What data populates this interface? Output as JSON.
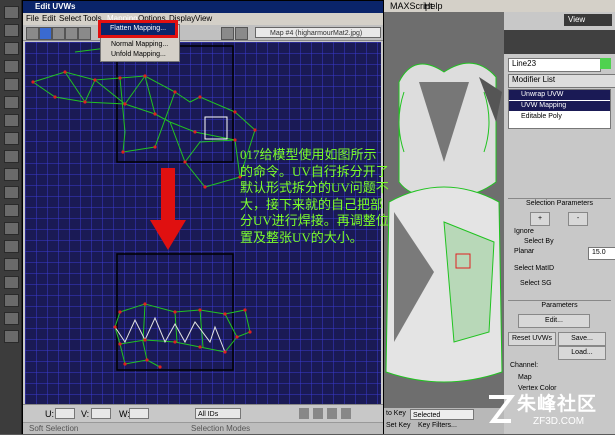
{
  "uvw_window": {
    "title": "Edit UVWs",
    "menu": [
      "File",
      "Edit",
      "Select",
      "Tools",
      "Mapping",
      "Options",
      "Display",
      "View"
    ],
    "texture_select": "Map #4 (higharmourMat2.jpg)",
    "dropdown_items": [
      "Flatten Mapping...",
      "Normal Mapping...",
      "Unfold Mapping..."
    ],
    "bottom": {
      "u_label": "U:",
      "v_label": "V:",
      "w_label": "W:",
      "ids_value": "All IDs"
    },
    "status_left": "Soft Selection",
    "status_right": "Selection Modes"
  },
  "max_menu": [
    "MAXScript",
    "Help"
  ],
  "command_panel": {
    "view_label": "View",
    "object_name": "Line23",
    "modifier_list": "Modifier List",
    "stack": [
      "Unwrap UVW",
      "UVW Mapping",
      "Editable Poly"
    ],
    "selection_params_title": "Selection Parameters",
    "plus": "+",
    "minus": "-",
    "ignore_label": "Ignore",
    "select_by_label": "Select By",
    "planar_label": "Planar",
    "planar_value": "15.0",
    "select_matid_label": "Select MatID",
    "select_sg_label": "Select SG",
    "parameters_title": "Parameters",
    "edit_button": "Edit...",
    "reset_uvws": "Reset UVWs",
    "save_button": "Save...",
    "load_button": "Load...",
    "channel_label": "Channel:",
    "map_label": "Map",
    "vertex_color_label": "Vertex Color"
  },
  "bottom_status": {
    "key_label": "to Key",
    "key_value": "Selected",
    "set_key": "Set Key",
    "key_filters": "Key Filters..."
  },
  "annotation": "017给模型使用如图所示\n的命令。UV自行拆分开了\n默认形式拆分的UV问题不\n大，接下来就的自己把部\n分UV进行焊接。再调整位\n置及整张UV的大小。",
  "watermark": {
    "main": "朱峰社区",
    "sub": "ZF3D.COM"
  },
  "colors": {
    "grid_bg": "#1a1a55",
    "grid_line": "#3a3ad0",
    "uv_edge": "#21c321",
    "uv_vertex": "#e02020",
    "annotation": "#7cff2a",
    "highlight": "#e01010"
  }
}
